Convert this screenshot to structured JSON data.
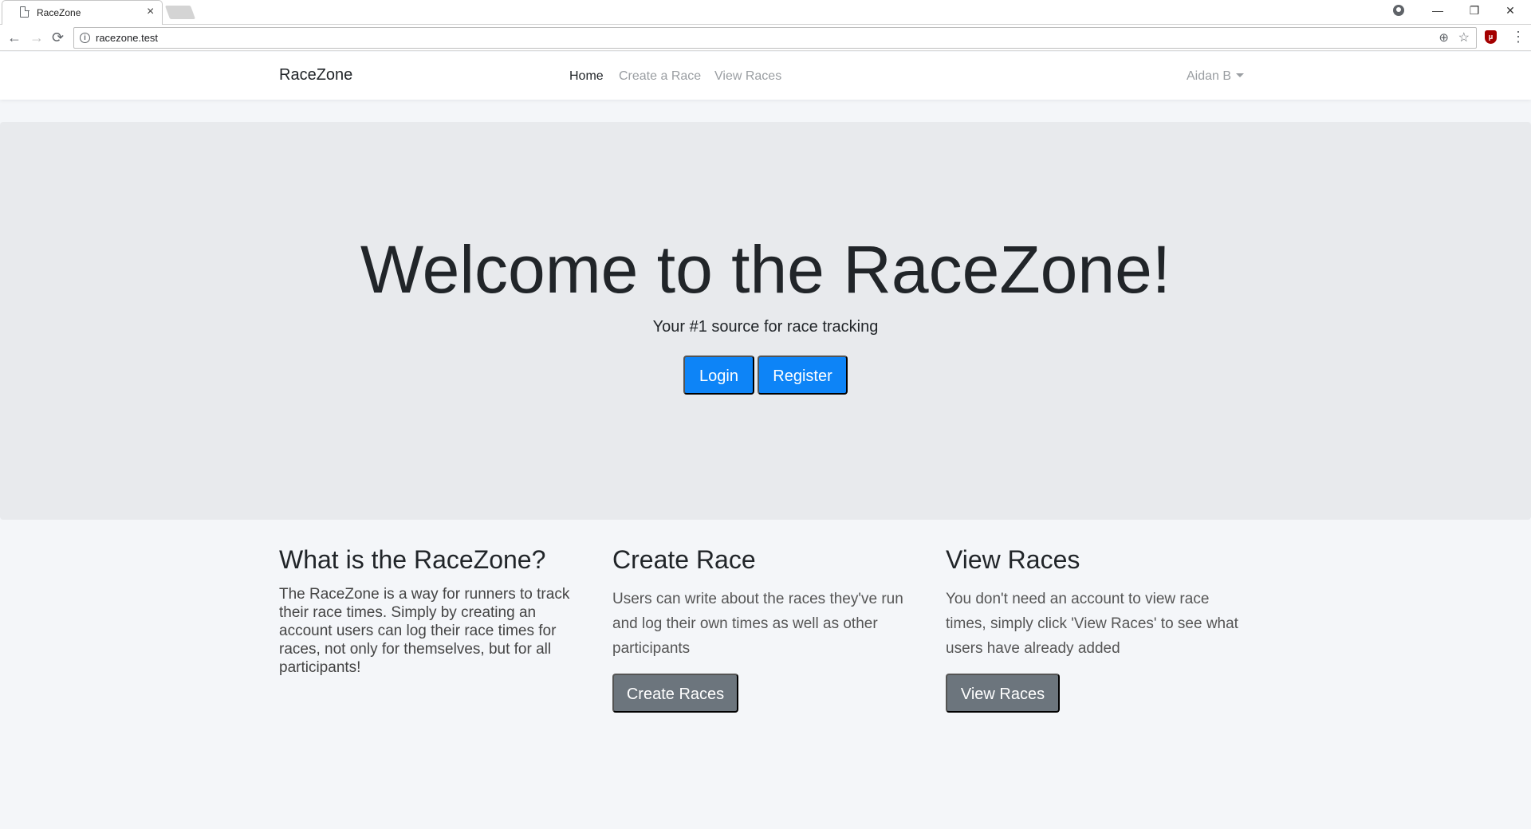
{
  "browser": {
    "tab_title": "RaceZone",
    "tab_close": "×",
    "url": "racezone.test",
    "back": "←",
    "forward": "→",
    "reload": "⟳",
    "minimize": "—",
    "restore": "❐",
    "close": "✕",
    "zoom_glyph": "⊕",
    "star_glyph": "☆",
    "menu_glyph": "⋮",
    "ublock_glyph": "μ",
    "info_glyph": "i"
  },
  "navbar": {
    "brand": "RaceZone",
    "links": [
      {
        "label": "Home",
        "active": true
      },
      {
        "label": "Create a Race",
        "active": false
      },
      {
        "label": "View Races",
        "active": false
      }
    ],
    "user": "Aidan B"
  },
  "hero": {
    "title": "Welcome to the RaceZone!",
    "subtitle": "Your #1 source for race tracking",
    "login_label": "Login",
    "register_label": "Register"
  },
  "columns": [
    {
      "title": "What is the RaceZone?",
      "text": "The RaceZone is a way for runners to track their race times. Simply by creating an account users can log their race times for races, not only for themselves, but for all participants!"
    },
    {
      "title": "Create Race",
      "text": "Users can write about the races they've run and log their own times as well as other participants",
      "button": "Create Races"
    },
    {
      "title": "View Races",
      "text": "You don't need an account to view race times, simply click 'View Races' to see what users have already added",
      "button": "View Races"
    }
  ],
  "colors": {
    "primary": "#0d84f7",
    "secondary": "#6c757d",
    "jumbotron_bg": "#e8eaed",
    "page_bg": "#f4f6f9"
  }
}
